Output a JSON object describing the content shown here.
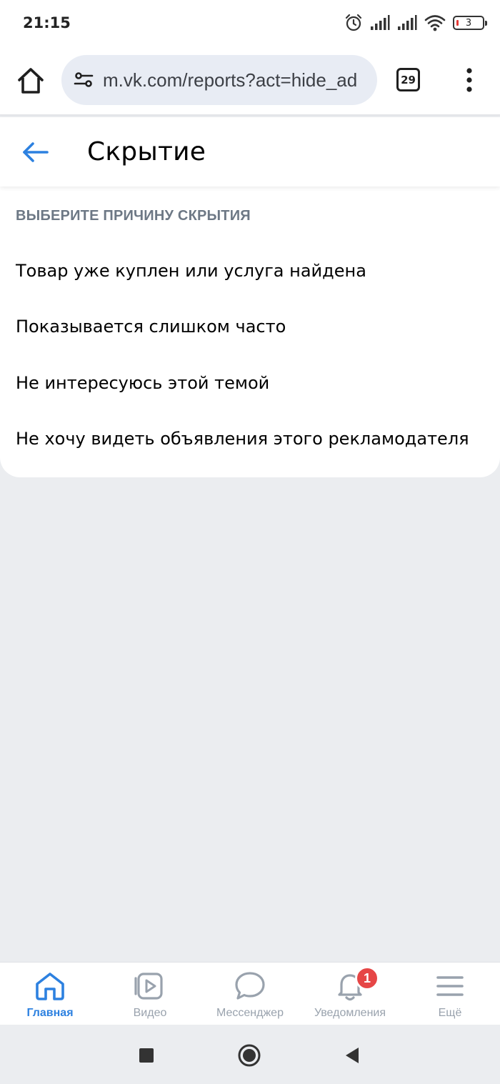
{
  "status_bar": {
    "time": "21:15",
    "battery_level": "3",
    "icons": [
      "alarm-icon",
      "signal-icon",
      "signal-icon",
      "wifi-icon",
      "battery-icon"
    ]
  },
  "browser": {
    "url": "m.vk.com/reports?act=hide_ad",
    "tab_count": "29"
  },
  "header": {
    "title": "Скрытие"
  },
  "reasons": {
    "caption": "ВЫБЕРИТЕ ПРИЧИНУ СКРЫТИЯ",
    "items": [
      {
        "label": "Товар уже куплен или услуга найдена"
      },
      {
        "label": "Показывается слишком часто"
      },
      {
        "label": "Не интересуюсь этой темой"
      },
      {
        "label": "Не хочу видеть объявления этого рекламодателя"
      }
    ]
  },
  "bottom_nav": {
    "items": [
      {
        "label": "Главная",
        "icon": "home-icon",
        "active": true
      },
      {
        "label": "Видео",
        "icon": "video-icon"
      },
      {
        "label": "Мессенджер",
        "icon": "messenger-icon"
      },
      {
        "label": "Уведомления",
        "icon": "bell-icon",
        "badge": "1"
      },
      {
        "label": "Ещё",
        "icon": "menu-icon"
      }
    ]
  },
  "colors": {
    "accent": "#2d81e0",
    "badge": "#e64646",
    "caption": "#6d7885",
    "inactive": "#99a2ad",
    "background": "#ebedf0"
  }
}
